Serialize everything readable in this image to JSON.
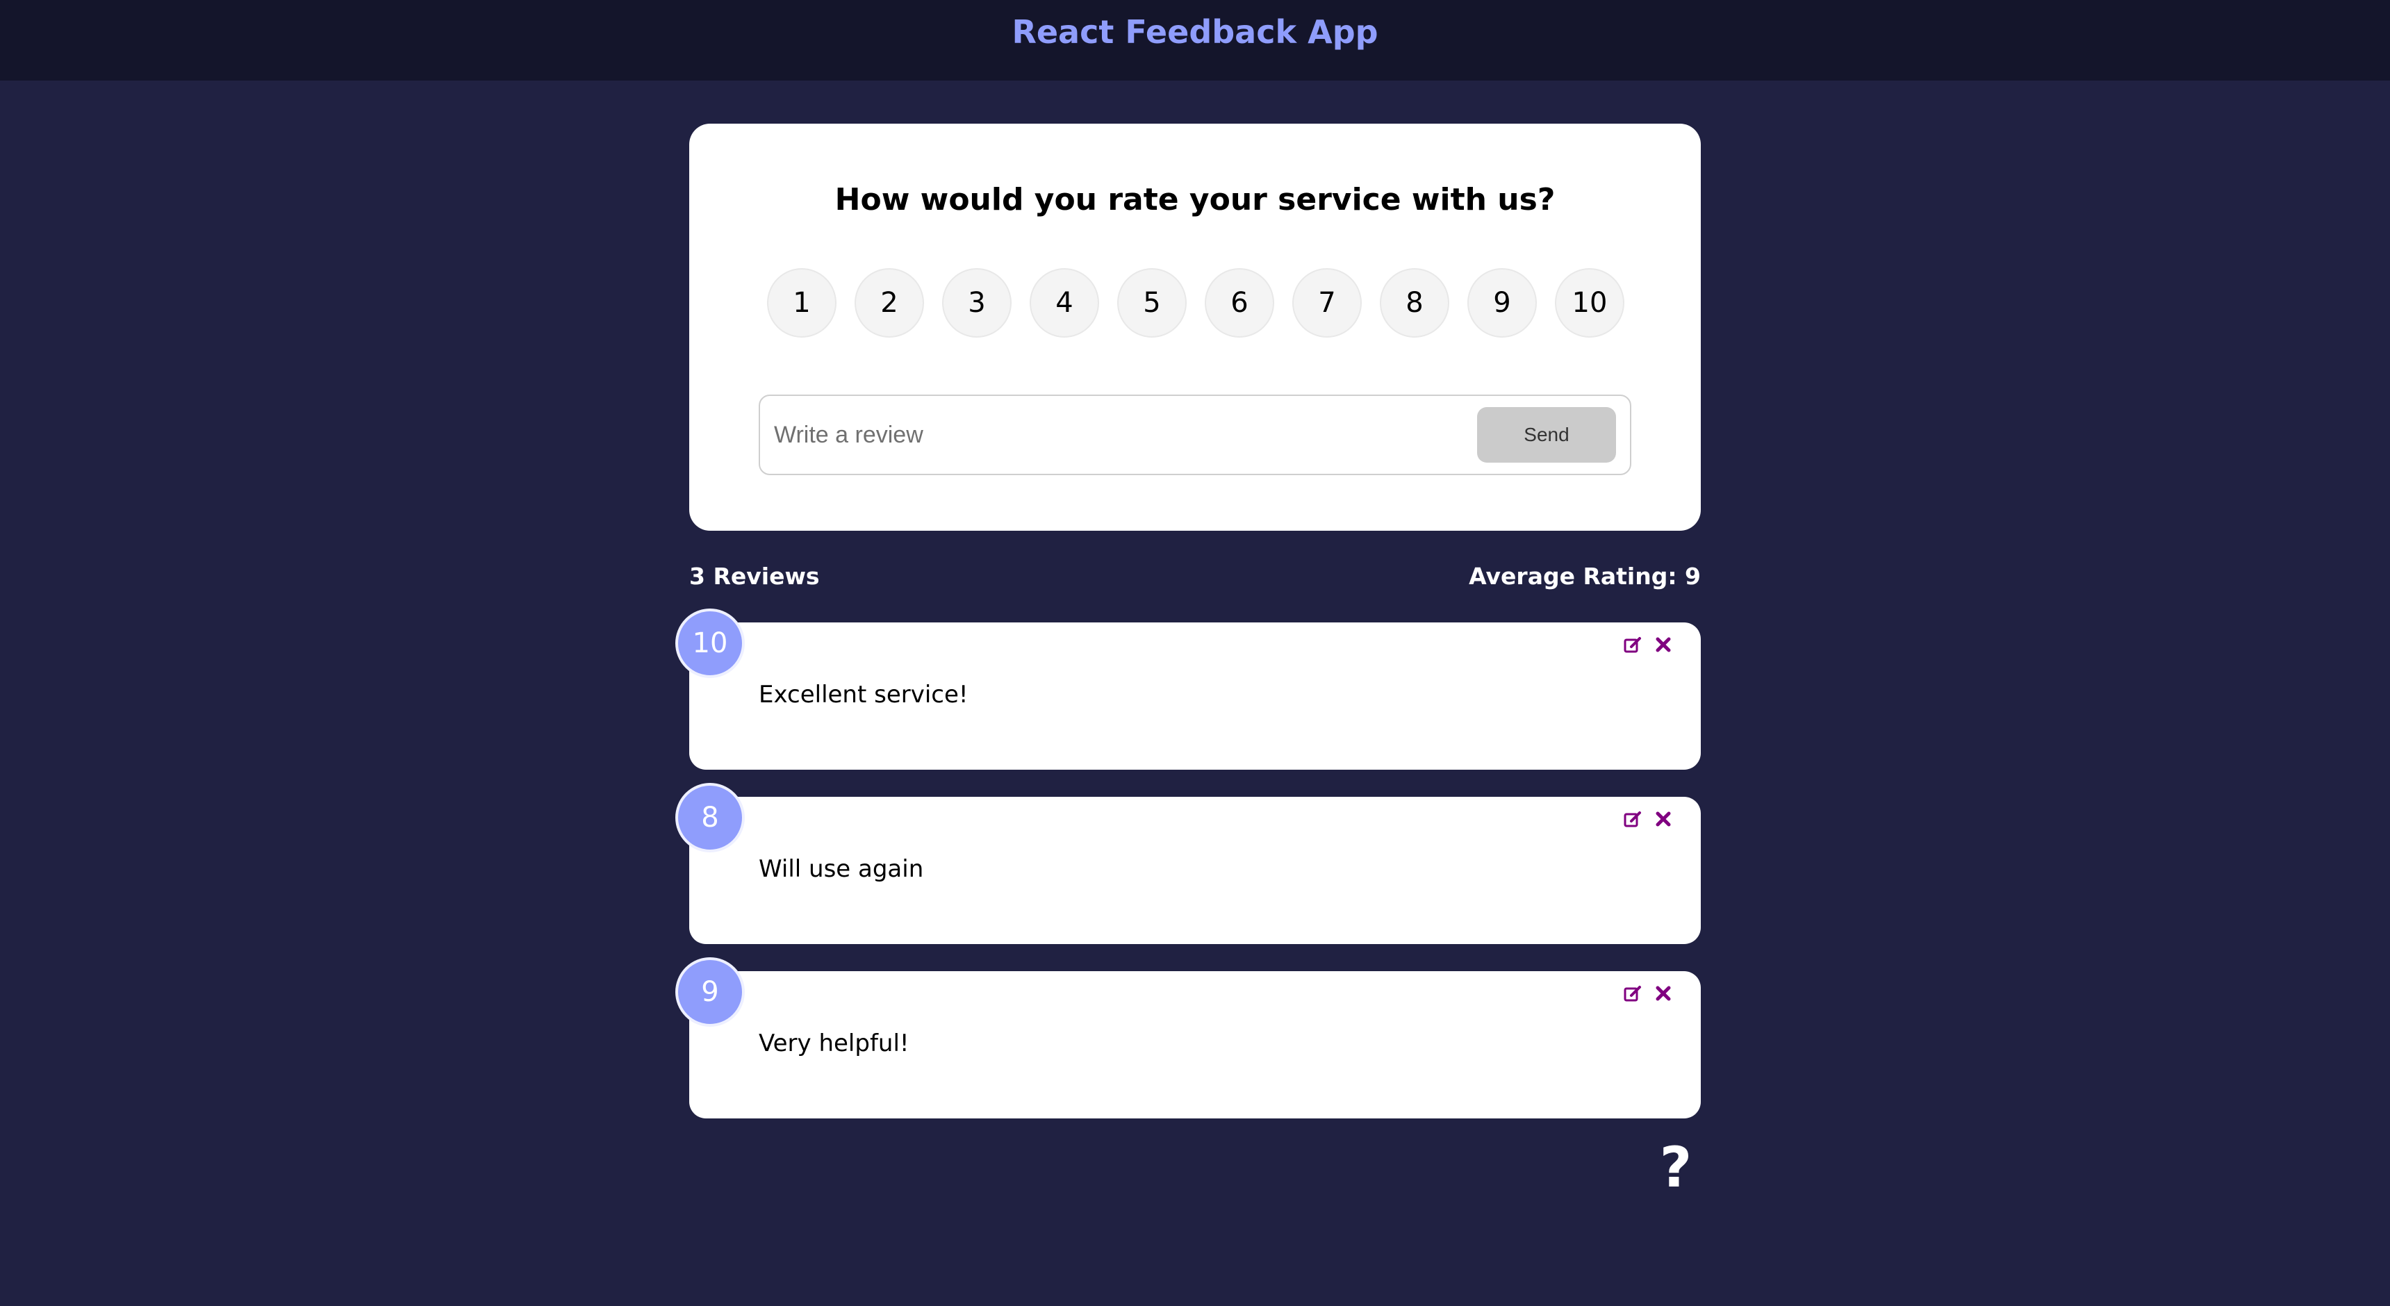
{
  "header": {
    "title": "React Feedback App"
  },
  "form": {
    "question": "How would you rate your service with us?",
    "ratings": [
      "1",
      "2",
      "3",
      "4",
      "5",
      "6",
      "7",
      "8",
      "9",
      "10"
    ],
    "input_placeholder": "Write a review",
    "input_value": "",
    "send_label": "Send"
  },
  "stats": {
    "count_label": "3 Reviews",
    "average_label": "Average Rating: 9"
  },
  "reviews": [
    {
      "rating": "10",
      "text": "Excellent service!"
    },
    {
      "rating": "8",
      "text": "Will use again"
    },
    {
      "rating": "9",
      "text": "Very helpful!"
    }
  ],
  "help": {
    "label": "?"
  },
  "colors": {
    "background": "#202142",
    "header": "#14152b",
    "accent": "#8f9dfc",
    "icon": "#800080"
  },
  "icons": [
    "edit-icon",
    "close-icon",
    "question-icon"
  ]
}
